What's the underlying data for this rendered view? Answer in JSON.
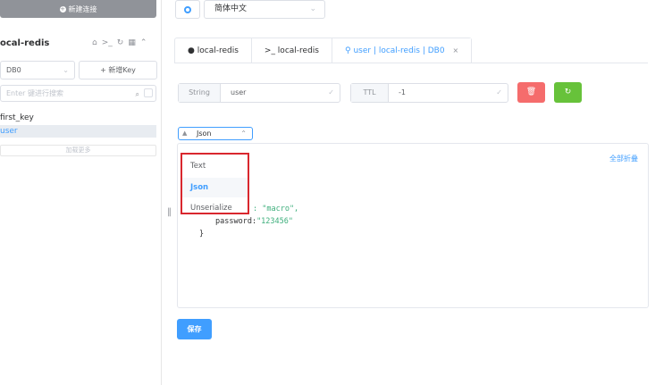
{
  "sidebar": {
    "new_connection": "新建连接",
    "connection_name": "ocal-redis",
    "db_select": "DB0",
    "new_key": "+ 新增Key",
    "search_placeholder": "Enter 键进行搜索",
    "keys": [
      "first_key",
      "user"
    ],
    "load_more": "加载更多"
  },
  "language": {
    "selected": "简体中文"
  },
  "tabs": [
    {
      "label": "local-redis",
      "icon": "info-icon"
    },
    {
      "label": ">_ local-redis",
      "icon": "terminal-icon"
    },
    {
      "label": "user | local-redis | DB0",
      "icon": "key-icon",
      "closable": true
    }
  ],
  "key_detail": {
    "type_label": "String",
    "key_value": "user",
    "ttl_label": "TTL",
    "ttl_value": "-1"
  },
  "format": {
    "selected": "Json",
    "options": [
      "Text",
      "Json",
      "Unserialize"
    ]
  },
  "editor": {
    "collapse_all": "全部折叠",
    "line1_tail": ": \"macro\",",
    "line2_key": "password:",
    "line2_val": "\"123456\"",
    "line3": "}"
  },
  "save_label": "保存",
  "colors": {
    "primary": "#409eff",
    "danger": "#f56c6c",
    "success": "#67c23a",
    "highlight_border": "#d9272e"
  }
}
